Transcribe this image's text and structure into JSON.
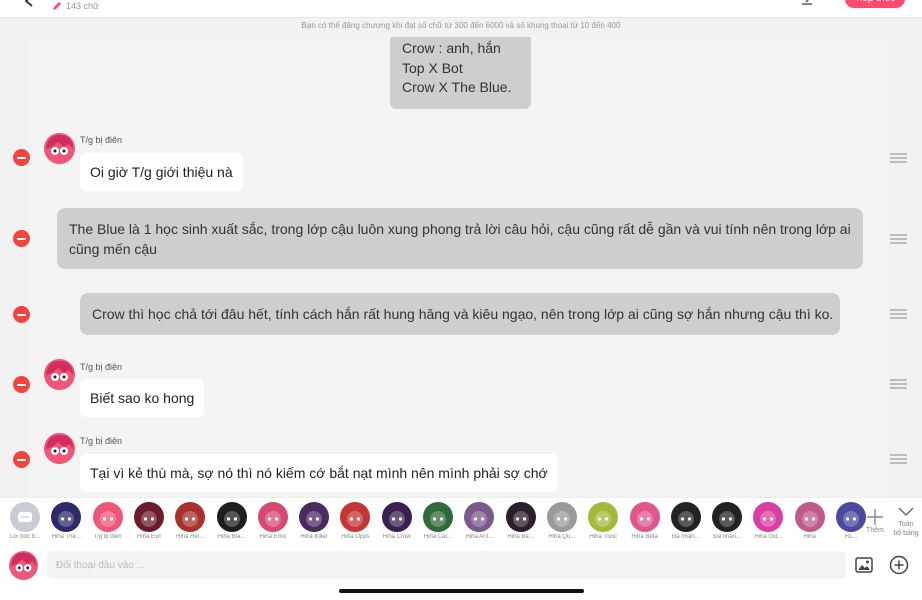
{
  "header": {
    "word_count": "143 chữ",
    "next_button": "Tiếp theo"
  },
  "info_line": "Bạn có thể đăng chương khi đạt số chữ từ 300 đến 6000 và số khung thoại từ 10 đến 400",
  "top_bubble": {
    "lines": [
      "Crow : anh, hắn",
      "Top X Bot",
      "Crow X The Blue."
    ]
  },
  "messages": [
    {
      "speaker": "T/g bị điên",
      "text": "Oi giờ T/g giới thiệu nà"
    },
    {
      "text": "The Blue là 1 học sinh xuất sắc, trong lớp cậu luôn xung phong trả lời câu hỏi, cậu cũng rất dễ gần và vui tính nên trong lớp ai cũng mến cậu"
    },
    {
      "text": "Crow thì học chả tới đâu hết, tính cách hắn rất hung hăng và kiêu ngạo, nên trong lớp ai cũng sợ hắn nhưng cậu thì ko."
    },
    {
      "speaker": "T/g bị điên",
      "text": "Biết sao ko hong"
    },
    {
      "speaker": "T/g bị điên",
      "text": "Tại vì kẻ thù mà, sợ nó thì nó kiếm cớ bắt nạt mình nên mình phải sợ chớ"
    }
  ],
  "characters": [
    {
      "name": "Lời bốc b...",
      "color": "#c8cdd3"
    },
    {
      "name": "Hiha The...",
      "color": "#2c2a6b"
    },
    {
      "name": "T/g bị điên",
      "color": "#f0567a"
    },
    {
      "name": "Hiha Evil",
      "color": "#6b1b2a"
    },
    {
      "name": "Hiha Hel...",
      "color": "#a6322b"
    },
    {
      "name": "Hiha Bla...",
      "color": "#1e1e1e"
    },
    {
      "name": "Hiha Emo",
      "color": "#d44a72"
    },
    {
      "name": "Hiha Killer",
      "color": "#4a2a60"
    },
    {
      "name": "Hiha Opps",
      "color": "#c43535"
    },
    {
      "name": "Hiha Crow",
      "color": "#3a2050"
    },
    {
      "name": "Hiha Cat...",
      "color": "#2f6b3a"
    },
    {
      "name": "Hiha Ant...",
      "color": "#7a5a8c"
    },
    {
      "name": "Hiha Ba...",
      "color": "#2a1f2a"
    },
    {
      "name": "Hiha Qu...",
      "color": "#9a9a9a"
    },
    {
      "name": "Hiha Toxic",
      "color": "#a4b83a"
    },
    {
      "name": "Hiha Beta",
      "color": "#e0568a"
    },
    {
      "name": "Đa nhân...",
      "color": "#222222"
    },
    {
      "name": "Đa nhân...",
      "color": "#222222"
    },
    {
      "name": "Hiha Glit...",
      "color": "#d93fa0"
    },
    {
      "name": "Hiha",
      "color": "#c05a8a"
    },
    {
      "name": "H1...",
      "color": "#4a4aa0"
    }
  ],
  "add_label": "Thêm",
  "all_label_lines": [
    "Toàn",
    "bộ bảng"
  ],
  "input": {
    "placeholder": "Đối thoại đầu vào ..."
  },
  "colors": {
    "accent": "#ff4a6e",
    "remove": "#f3453f",
    "narration_bubble": "#cecece"
  }
}
